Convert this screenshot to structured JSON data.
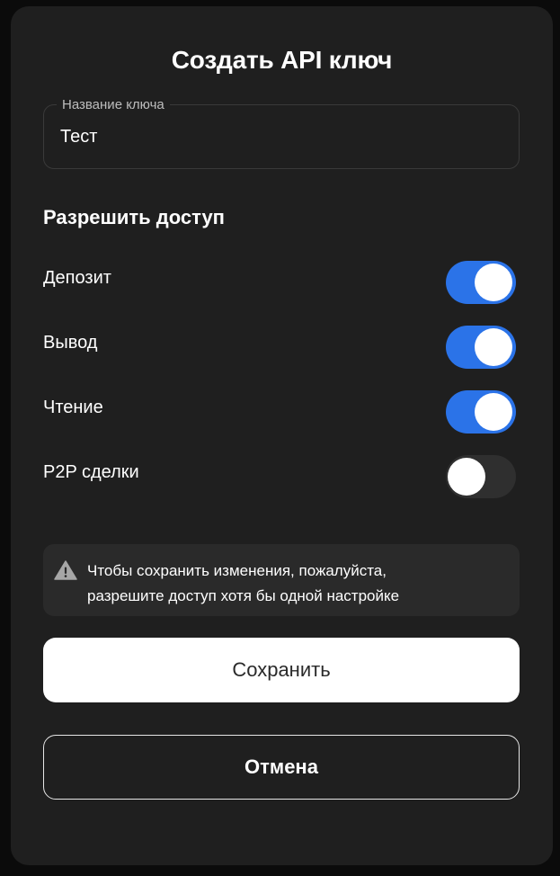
{
  "dialog": {
    "title": "Создать API ключ"
  },
  "key_name_field": {
    "label": "Название ключа",
    "value": "Тест"
  },
  "access": {
    "title": "Разрешить доступ",
    "permissions": [
      {
        "label": "Депозит",
        "enabled": true
      },
      {
        "label": "Вывод",
        "enabled": true
      },
      {
        "label": "Чтение",
        "enabled": true
      },
      {
        "label": "P2P сделки",
        "enabled": false
      }
    ]
  },
  "warning": {
    "icon": "warning-triangle-icon",
    "line1": "Чтобы сохранить изменения, пожалуйста,",
    "line2": "разрешите доступ хотя бы одной настройке"
  },
  "buttons": {
    "save_label": "Сохранить",
    "cancel_label": "Отмена"
  },
  "colors": {
    "toggle_on": "#2b73e8",
    "toggle_off": "#2f2f2f",
    "background": "#1f1f1f"
  }
}
